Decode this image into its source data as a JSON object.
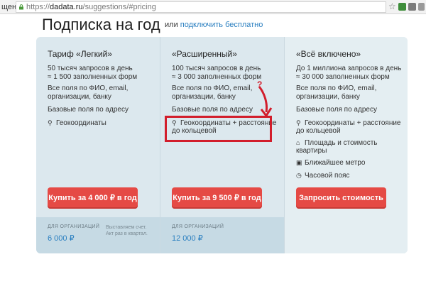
{
  "browser": {
    "left_fragment": "щено",
    "url_scheme": "https://",
    "url_host": "dadata.ru",
    "url_path": "/suggestions/#pricing"
  },
  "page": {
    "heading": "Подписка на год",
    "or_text": "или",
    "free_link": "подключить бесплатно"
  },
  "plans": [
    {
      "title": "Тариф «Легкий»",
      "lines": [
        "50 тысяч запросов в день",
        "≈ 1 500 заполненных форм",
        "Все поля по ФИО, email,",
        "организации, банку",
        "Базовые поля по адресу",
        "Геокоординаты"
      ],
      "button": "Купить за 4 000 ₽ в год",
      "foot_label": "ДЛЯ ОРГАНИЗАЦИЙ",
      "foot_price": "6 000 ₽",
      "foot_note_1": "Выставляем счет.",
      "foot_note_2": "Акт раз в квартал."
    },
    {
      "title": "«Расширенный»",
      "lines": [
        "100 тысяч запросов в день",
        "≈ 3 000 заполненных форм",
        "Все поля по ФИО, email,",
        "организации, банку",
        "Базовые поля по адресу",
        "Геокоординаты + расстояние",
        "до кольцевой"
      ],
      "button": "Купить за 9 500 ₽ в год",
      "foot_label": "ДЛЯ ОРГАНИЗАЦИЙ",
      "foot_price": "12 000 ₽"
    },
    {
      "title": "«Всё включено»",
      "lines": [
        "До 1 миллиона запросов в день",
        "≈ 30 000 заполненных форм",
        "Все поля по ФИО, email,",
        "организации, банку",
        "Базовые поля по адресу",
        "Геокоординаты + расстояние",
        "до кольцевой",
        "Площадь и стоимость",
        "квартиры",
        "Ближайшее метро",
        "Часовой пояс"
      ],
      "button": "Запросить стоимость"
    }
  ],
  "annotation": {
    "question_mark": "?",
    "color": "#d21d2b"
  },
  "colors": {
    "accent_button": "#e54a45",
    "link": "#2a7fc0",
    "panel_bg": "#dce8ee"
  }
}
